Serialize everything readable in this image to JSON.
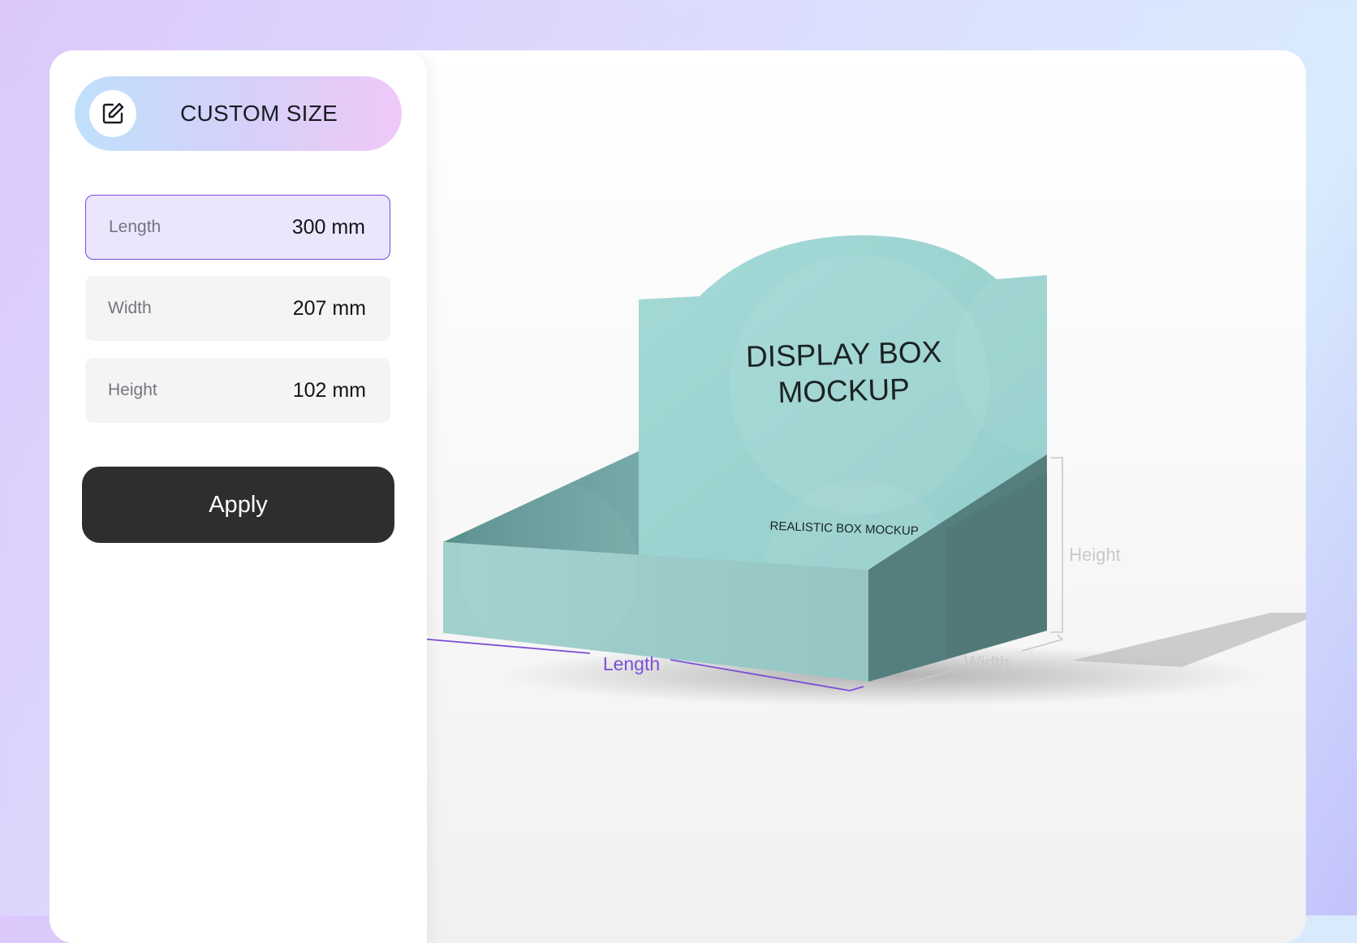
{
  "sidebar": {
    "mode": {
      "label": "CUSTOM SIZE",
      "icon": "edit-icon"
    },
    "fields": [
      {
        "label": "Length",
        "value": "300 mm",
        "active": true
      },
      {
        "label": "Width",
        "value": "207 mm",
        "active": false
      },
      {
        "label": "Height",
        "value": "102 mm",
        "active": false
      }
    ],
    "apply_label": "Apply"
  },
  "preview": {
    "box": {
      "title_line1": "DISPLAY BOX",
      "title_line2": "MOCKUP",
      "subtitle": "REALISTIC BOX MOCKUP",
      "color": "#9ed5d2"
    },
    "dimensions": {
      "length_label": "Length",
      "width_label": "Width",
      "height_label": "Height",
      "highlight_color": "#7b4fd6",
      "muted_color": "#c9c9cc"
    }
  }
}
